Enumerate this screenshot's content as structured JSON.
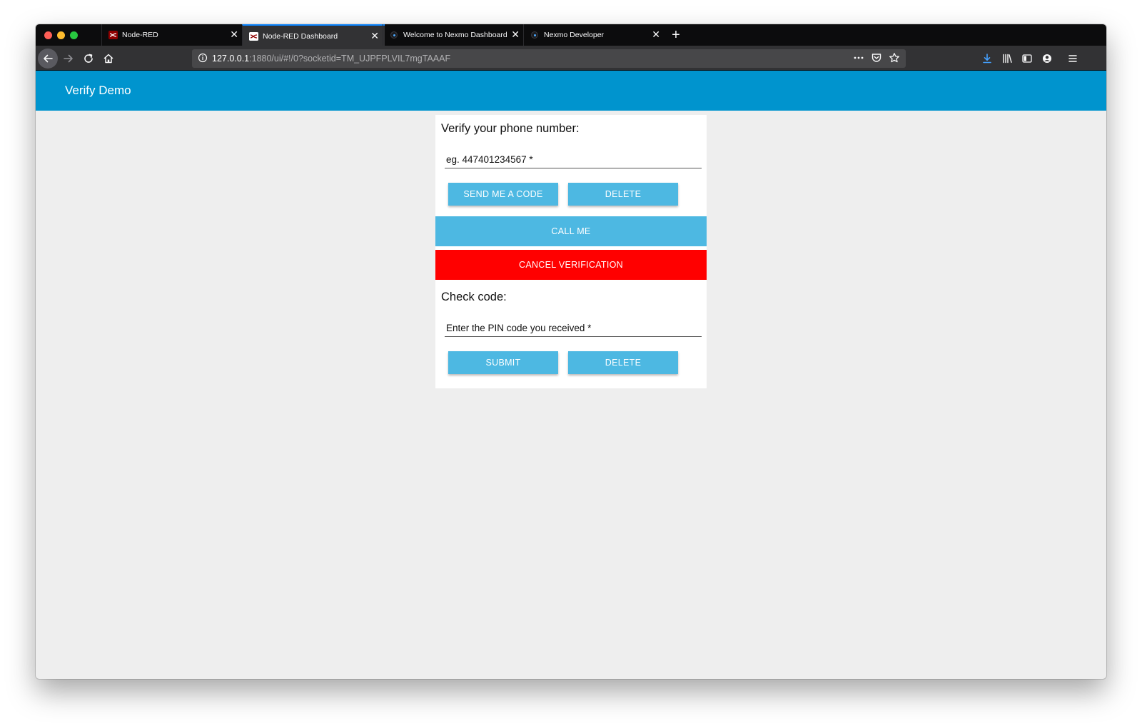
{
  "browser": {
    "tabs": [
      {
        "title": "Node-RED",
        "active": false,
        "favicon": "node-red-icon"
      },
      {
        "title": "Node-RED Dashboard",
        "active": true,
        "favicon": "node-red-icon"
      },
      {
        "title": "Welcome to Nexmo Dashboard",
        "active": false,
        "favicon": "nexmo-icon"
      },
      {
        "title": "Nexmo Developer",
        "active": false,
        "favicon": "nexmo-icon"
      }
    ],
    "url_host": "127.0.0.1",
    "url_rest": ":1880/ui/#!/0?socketid=TM_UJPFPLVIL7mgTAAAF",
    "accent_color": "#0a84ff"
  },
  "app": {
    "title": "Verify Demo",
    "header_color": "#0094ce"
  },
  "verify": {
    "heading": "Verify your phone number:",
    "phone_placeholder": "eg. 447401234567 *",
    "send_code_label": "SEND ME A CODE",
    "delete_label": "DELETE",
    "call_me_label": "CALL ME",
    "cancel_label": "CANCEL VERIFICATION",
    "button_color": "#4db8e2",
    "cancel_color": "#ff0000"
  },
  "check": {
    "heading": "Check code:",
    "pin_placeholder": "Enter the PIN code you received *",
    "submit_label": "SUBMIT",
    "delete_label": "DELETE"
  }
}
